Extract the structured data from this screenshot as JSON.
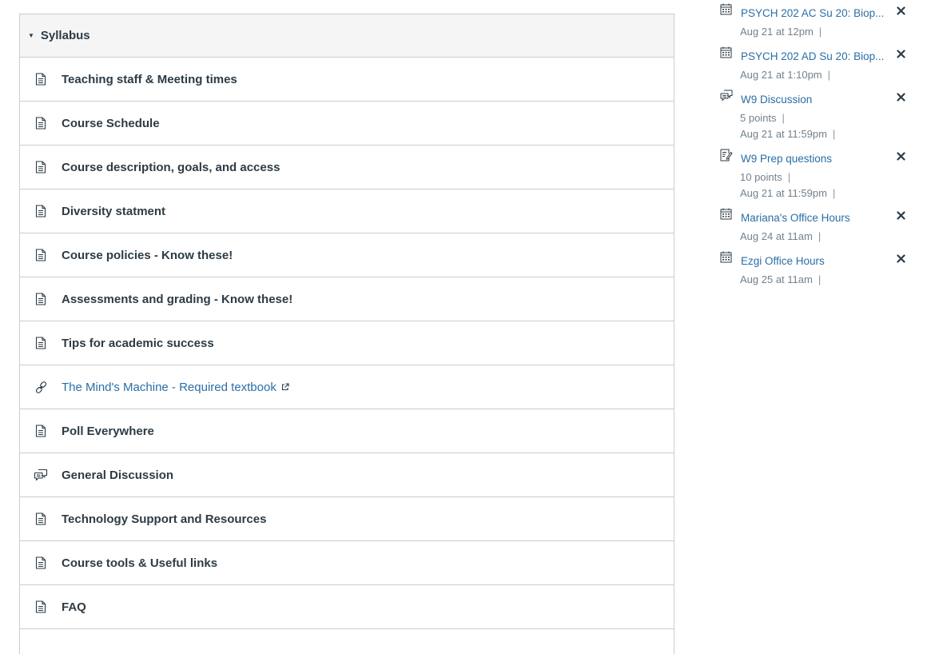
{
  "module": {
    "title": "Syllabus",
    "items": [
      {
        "label": "Teaching staff & Meeting times",
        "icon": "page-icon",
        "type": "page"
      },
      {
        "label": "Course Schedule",
        "icon": "page-icon",
        "type": "page"
      },
      {
        "label": "Course description, goals, and access",
        "icon": "page-icon",
        "type": "page"
      },
      {
        "label": "Diversity statment",
        "icon": "page-icon",
        "type": "page"
      },
      {
        "label": "Course policies - Know these!",
        "icon": "page-icon",
        "type": "page"
      },
      {
        "label": "Assessments and grading - Know these!",
        "icon": "page-icon",
        "type": "page"
      },
      {
        "label": "Tips for academic success",
        "icon": "page-icon",
        "type": "page"
      },
      {
        "label": "The Mind's Machine - Required textbook",
        "icon": "link-icon",
        "type": "external-link"
      },
      {
        "label": "Poll Everywhere",
        "icon": "page-icon",
        "type": "page"
      },
      {
        "label": "General Discussion",
        "icon": "discussion-icon",
        "type": "discussion"
      },
      {
        "label": "Technology Support and Resources",
        "icon": "page-icon",
        "type": "page"
      },
      {
        "label": "Course tools & Useful links",
        "icon": "page-icon",
        "type": "page"
      },
      {
        "label": "FAQ",
        "icon": "page-icon",
        "type": "page"
      }
    ]
  },
  "todo": {
    "items": [
      {
        "title": "PSYCH 202 AC Su 20: Biop...",
        "icon": "calendar-icon",
        "date": "Aug 21 at 12pm"
      },
      {
        "title": "PSYCH 202 AD Su 20: Biop...",
        "icon": "calendar-icon",
        "date": "Aug 21 at 1:10pm"
      },
      {
        "title": "W9 Discussion",
        "icon": "discussion-icon",
        "points": "5 points",
        "date": "Aug 21 at 11:59pm"
      },
      {
        "title": "W9 Prep questions",
        "icon": "quiz-icon",
        "points": "10 points",
        "date": "Aug 21 at 11:59pm"
      },
      {
        "title": "Mariana's Office Hours",
        "icon": "calendar-icon",
        "date": "Aug 24 at 11am"
      },
      {
        "title": "Ezgi Office Hours",
        "icon": "calendar-icon",
        "date": "Aug 25 at 11am"
      }
    ],
    "separator": "|"
  },
  "colors": {
    "link": "#2b6ea6",
    "text": "#2d3b45",
    "muted": "#73818c",
    "border": "#c7cdd1",
    "header_bg": "#f5f5f5"
  }
}
